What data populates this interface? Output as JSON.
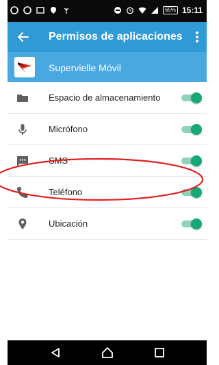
{
  "status_bar": {
    "time": "15:11",
    "battery": "65%"
  },
  "app_bar": {
    "title": "Permisos de aplicaciones"
  },
  "app_header": {
    "app_name": "Supervielle Móvil"
  },
  "permissions": [
    {
      "label": "Espacio de almacenamiento",
      "icon": "folder-icon",
      "enabled": true
    },
    {
      "label": "Micrófono",
      "icon": "microphone-icon",
      "enabled": true
    },
    {
      "label": "SMS",
      "icon": "sms-icon",
      "enabled": true
    },
    {
      "label": "Teléfono",
      "icon": "phone-icon",
      "enabled": true
    },
    {
      "label": "Ubicación",
      "icon": "location-icon",
      "enabled": true
    }
  ],
  "colors": {
    "app_bar": "#2f9ad6",
    "app_header": "#4aa8e0",
    "toggle_on": "#16a877",
    "highlight": "#e02020"
  }
}
